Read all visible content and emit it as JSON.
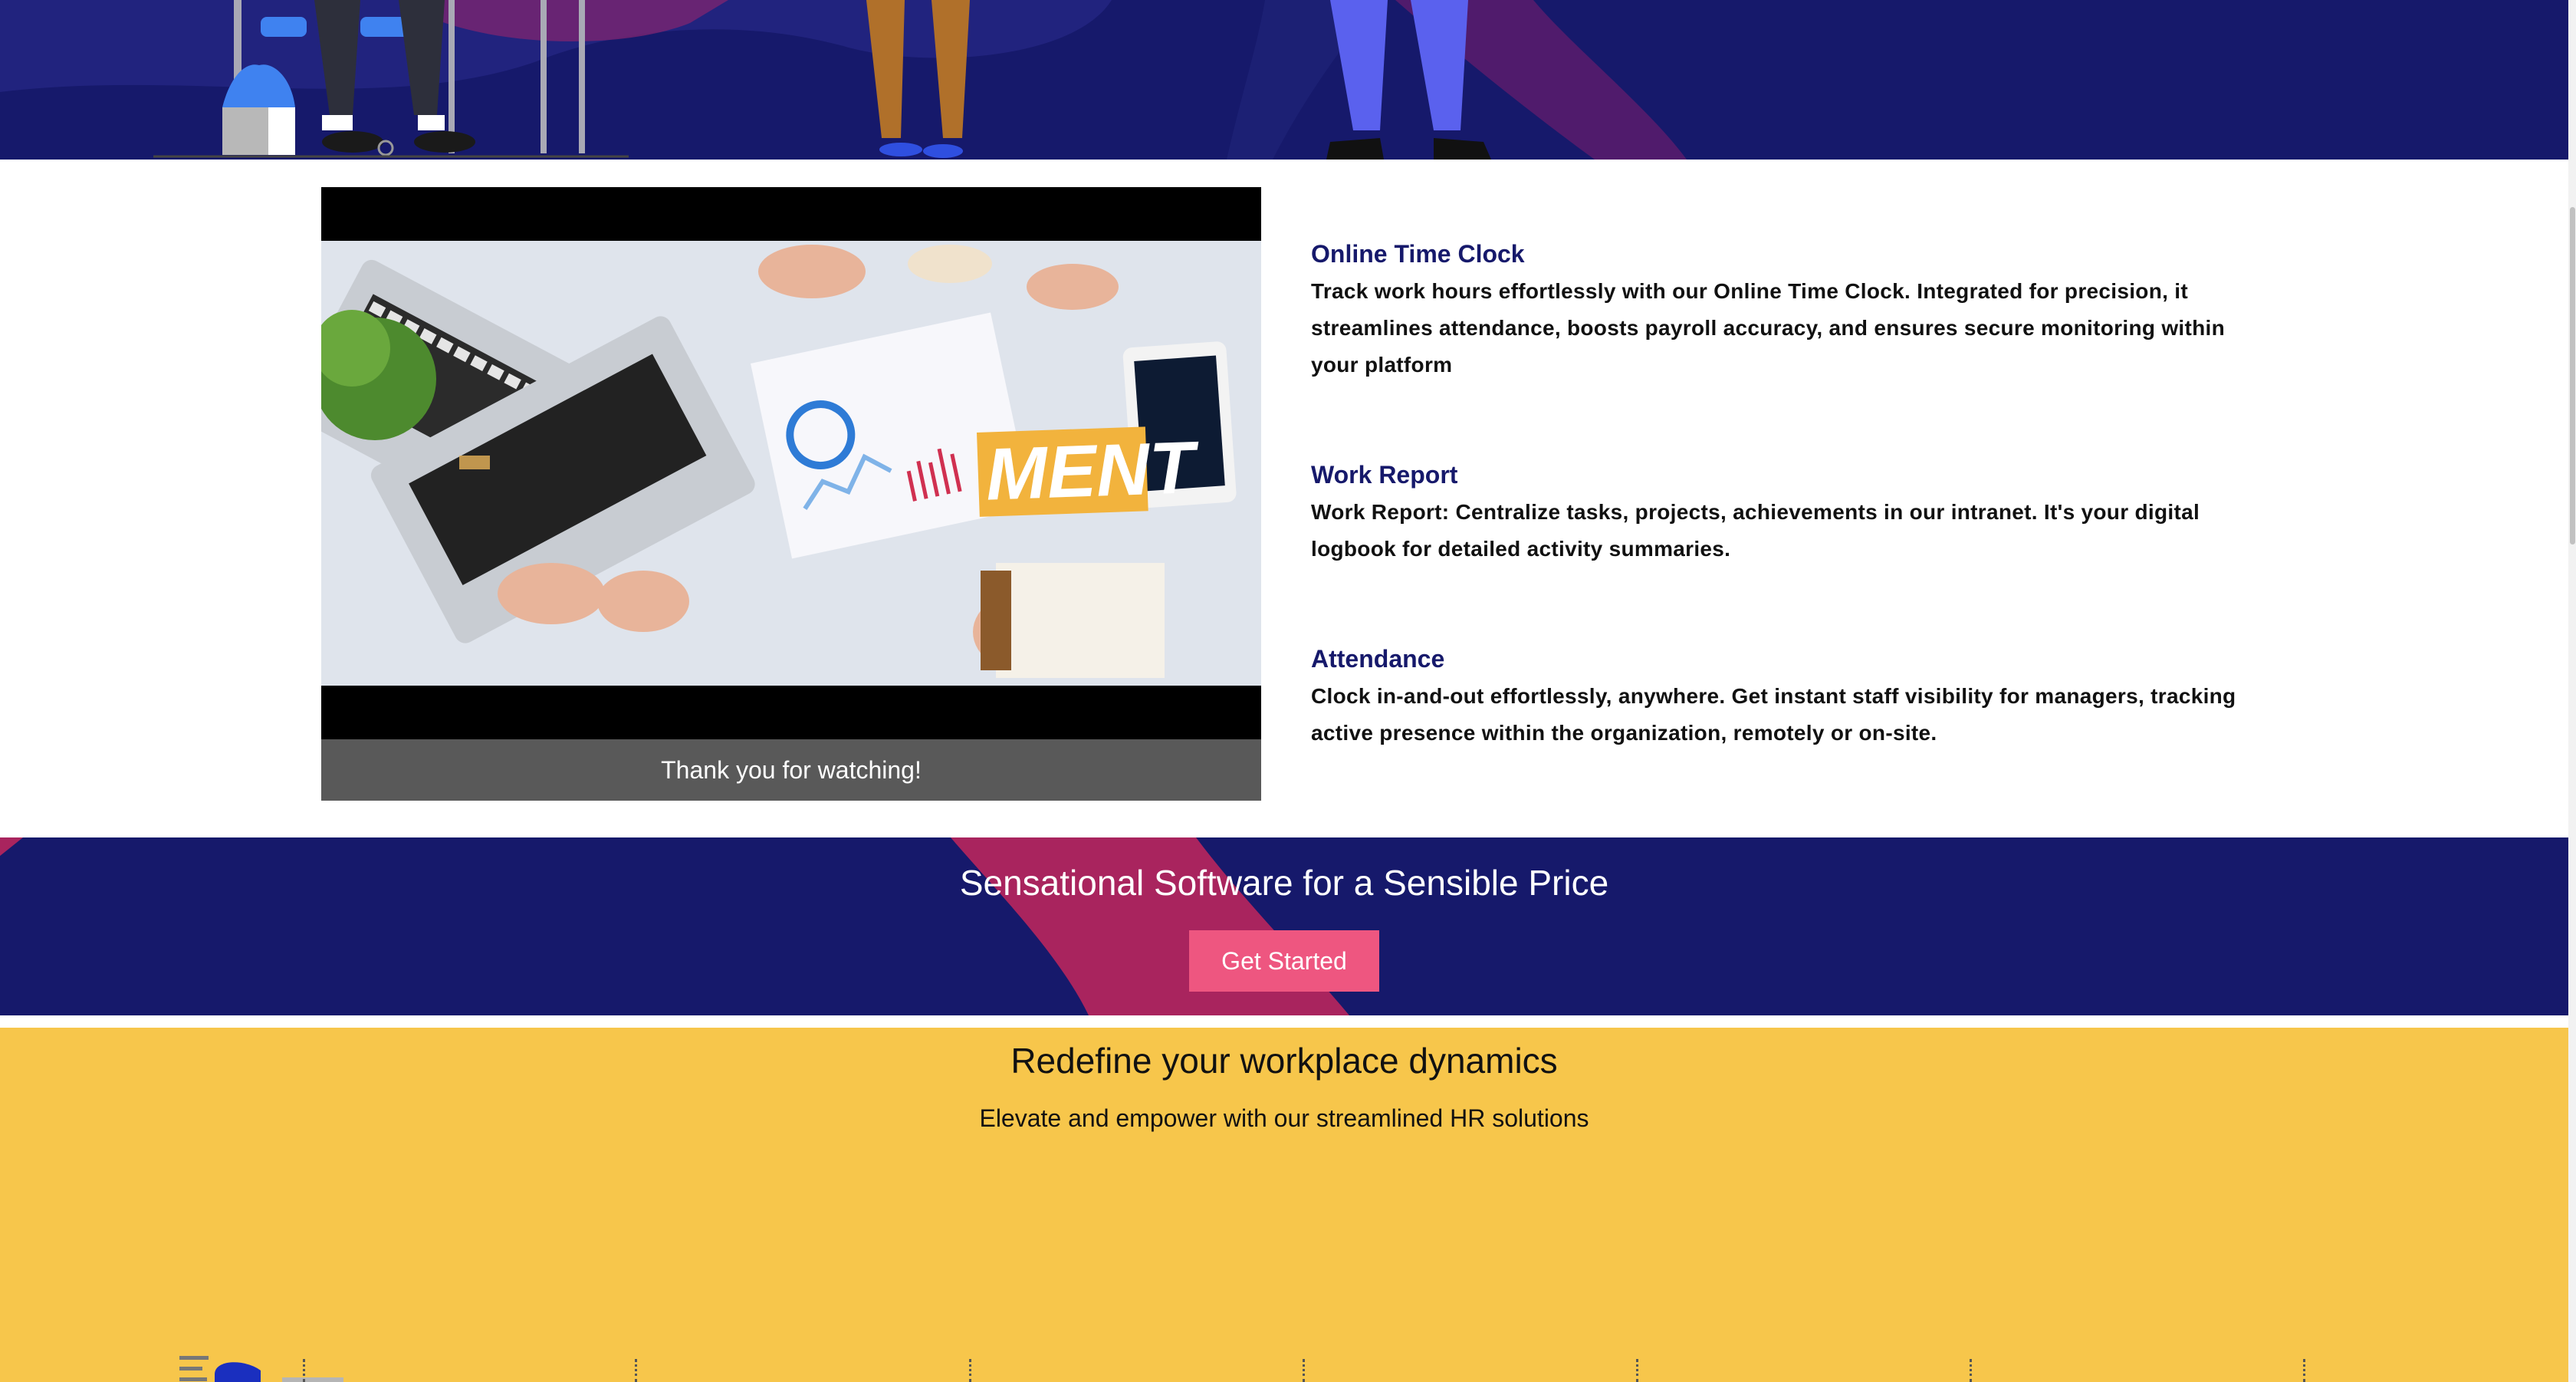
{
  "video": {
    "caption": "Thank you for watching!",
    "overlay_text": "MENT"
  },
  "features": [
    {
      "title": "Online Time Clock",
      "lines": [
        "Track work hours effortlessly with our Online Time Clock. Integrated for precision, it",
        "streamlines attendance, boosts payroll accuracy, and ensures secure monitoring within",
        "your platform"
      ]
    },
    {
      "title": "Work Report",
      "lines": [
        "Work Report: Centralize tasks, projects, achievements in our intranet. It's your digital",
        "logbook for detailed activity summaries."
      ]
    },
    {
      "title": "Attendance",
      "lines": [
        "Clock in-and-out effortlessly, anywhere. Get instant staff visibility for managers, tracking",
        "active presence within the organization, remotely or on-site."
      ]
    }
  ],
  "cta": {
    "title": "Sensational Software for a Sensible Price",
    "button_label": "Get Started"
  },
  "dynamics": {
    "title": "Redefine your workplace dynamics",
    "subtitle": "Elevate and empower with our streamlined HR solutions"
  },
  "colors": {
    "navy": "#16196b",
    "accent_pink": "#ee5680",
    "magenta": "#a9245e",
    "yellow": "#f7c64b"
  }
}
